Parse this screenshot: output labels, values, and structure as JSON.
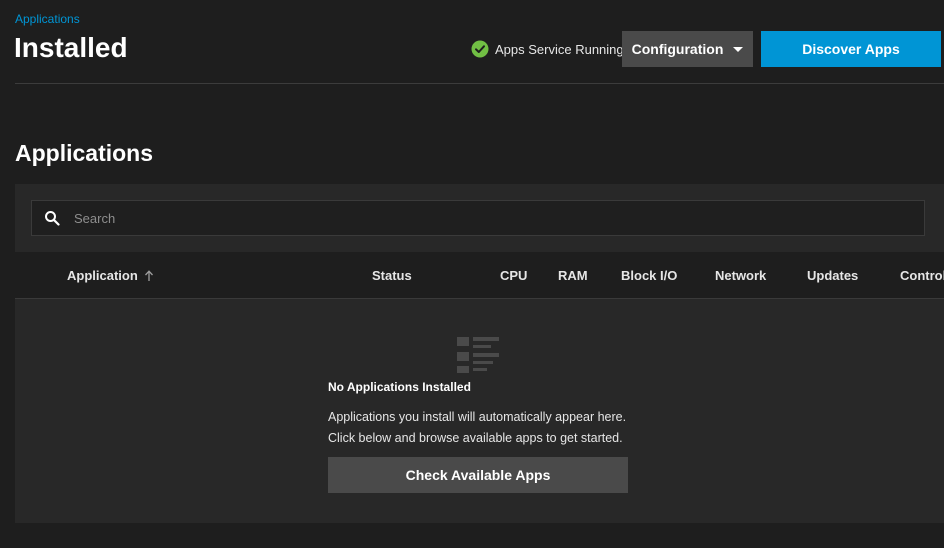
{
  "breadcrumb": "Applications",
  "page_title": "Installed",
  "status": {
    "text": "Apps Service Running",
    "icon": "check-circle-icon",
    "color": "#71bf44"
  },
  "toolbar": {
    "configuration_label": "Configuration",
    "discover_label": "Discover Apps",
    "accent_color": "#0095d5"
  },
  "section_title": "Applications",
  "search": {
    "placeholder": "Search",
    "value": ""
  },
  "table": {
    "columns": [
      "Application",
      "Status",
      "CPU",
      "RAM",
      "Block I/O",
      "Network",
      "Updates",
      "Controls"
    ],
    "sort_column": "Application",
    "sort_direction": "ascending"
  },
  "empty_state": {
    "icon": "list-icon",
    "title": "No Applications Installed",
    "line1": "Applications you install will automatically appear here.",
    "line2": "Click below and browse available apps to get started.",
    "button_label": "Check Available Apps"
  }
}
